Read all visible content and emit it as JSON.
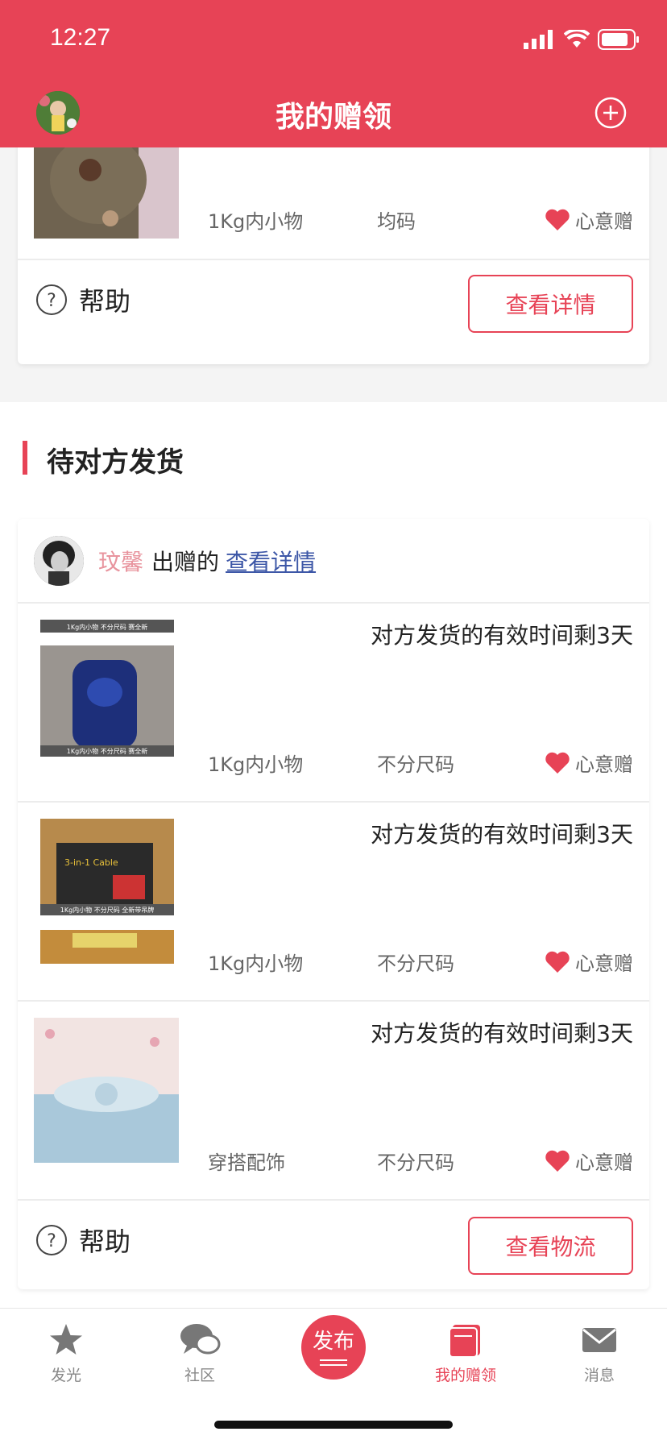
{
  "status_bar": {
    "time": "12:27"
  },
  "nav": {
    "title": "我的赠领"
  },
  "top_card": {
    "item": {
      "category": "1Kg内小物",
      "size": "均码",
      "tag": "心意赠"
    },
    "help_label": "帮助",
    "action_label": "查看详情"
  },
  "section": {
    "title": "待对方发货",
    "giver_name": "玟馨",
    "giver_text": "出赠的",
    "giver_link": "查看详情",
    "items": [
      {
        "deadline": "对方发货的有效时间剩3天",
        "category": "1Kg内小物",
        "size": "不分尺码",
        "tag": "心意赠"
      },
      {
        "deadline": "对方发货的有效时间剩3天",
        "category": "1Kg内小物",
        "size": "不分尺码",
        "tag": "心意赠"
      },
      {
        "deadline": "对方发货的有效时间剩3天",
        "category": "穿搭配饰",
        "size": "不分尺码",
        "tag": "心意赠"
      }
    ],
    "help_label": "帮助",
    "action_label": "查看物流"
  },
  "thumb_text": {
    "thumb1_top": "1Kg内小物   不分尺码   赛全新",
    "thumb1_bottom": "1Kg内小物   不分尺码   赛全新",
    "thumb2_label": "3-in-1 Cable",
    "thumb2_bottom": "1Kg内小物   不分尺码   全新带吊牌"
  },
  "tabbar": {
    "tabs": [
      {
        "label": "发光",
        "icon": "star-icon"
      },
      {
        "label": "社区",
        "icon": "chat-bubbles-icon"
      },
      {
        "label": "发布",
        "icon": "publish-icon"
      },
      {
        "label": "我的赠领",
        "icon": "gift-book-icon"
      },
      {
        "label": "消息",
        "icon": "mail-icon"
      }
    ],
    "active": "我的赠领"
  },
  "colors": {
    "brand": "#e74356",
    "link": "#3d57a7",
    "giver_name": "#e8949e"
  }
}
